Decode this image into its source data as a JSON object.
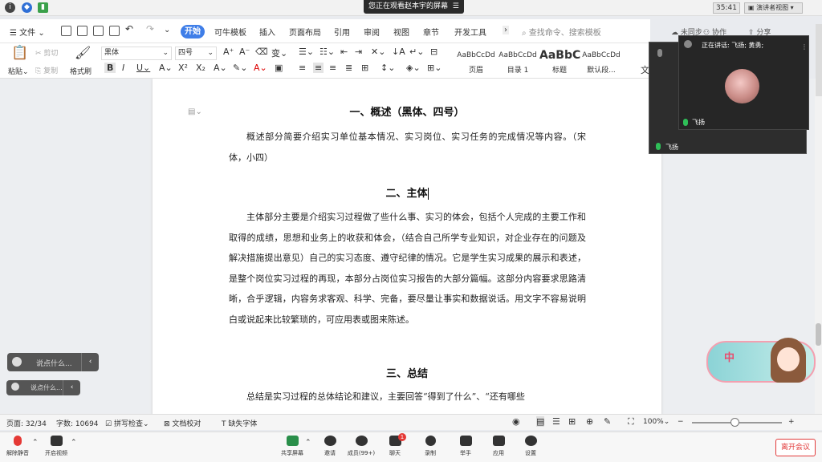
{
  "system": {
    "share_banner": "您正在观看赵本宇的屏幕",
    "time": "35:41",
    "presenter_view": "演讲者视图"
  },
  "menu": {
    "file": "文件",
    "tabs": [
      "开始",
      "可牛模板",
      "插入",
      "页面布局",
      "引用",
      "审阅",
      "视图",
      "章节",
      "开发工具"
    ],
    "search_placeholder": "查找命令、搜索模板",
    "unsync": "未同步",
    "collab": "协作",
    "share": "分享"
  },
  "toolbar": {
    "paste": "粘贴",
    "cut": "剪切",
    "copy": "复制",
    "format_painter": "格式刷",
    "font": "黑体",
    "size": "四号",
    "styles": [
      {
        "sample": "AaBbCcDd",
        "name": "页眉"
      },
      {
        "sample": "AaBbCcDd",
        "name": "目录 1"
      },
      {
        "sample": "AaBbC",
        "name": "标题"
      },
      {
        "sample": "AaBbCcDd",
        "name": "默认段..."
      }
    ],
    "more_text": "文"
  },
  "document": {
    "h1": "一、概述（黑体、四号）",
    "p1": "概述部分简要介绍实习单位基本情况、实习岗位、实习任务的完成情况等内容。（宋体，小四）",
    "h2": "二、主体",
    "p2": "主体部分主要是介绍实习过程做了些什么事、实习的体会，包括个人完成的主要工作和取得的成绩，思想和业务上的收获和体会，（结合自己所学专业知识，对企业存在的问题及解决措施提出意见）自己的实习态度、遵守纪律的情况。它是学生实习成果的展示和表述，是整个岗位实习过程的再现，本部分占岗位实习报告的大部分篇幅。这部分内容要求思路清晰，合乎逻辑，内容务求客观、科学、完备，要尽量让事实和数据说话。用文字不容易说明白或说起来比较繁琐的，可应用表或图来陈述。",
    "h3": "三、总结",
    "p3": "总结是实习过程的总体结论和建议，主要回答“得到了什么”、“还有哪些"
  },
  "status": {
    "page": "页面: 32/34",
    "words": "字数: 10694",
    "spell": "拼写检查",
    "proof": "文档校对",
    "missing_font": "缺失字体",
    "zoom": "100%"
  },
  "meeting": {
    "mute": "解除静音",
    "video": "开启视频",
    "share": "共享屏幕",
    "invite": "邀请",
    "members": "成员(99+)",
    "chat": "聊天",
    "chat_badge": "1",
    "record": "录制",
    "raise": "举手",
    "apps": "应用",
    "settings": "设置",
    "leave": "离开会议"
  },
  "video": {
    "speaking": "正在讲话: 飞扬; 黄勇;",
    "name_inner": "飞扬",
    "name_outer": "飞扬"
  },
  "chat": {
    "placeholder1": "说点什么...",
    "placeholder2": "说点什么..."
  },
  "cartoon": {
    "text": "中"
  }
}
